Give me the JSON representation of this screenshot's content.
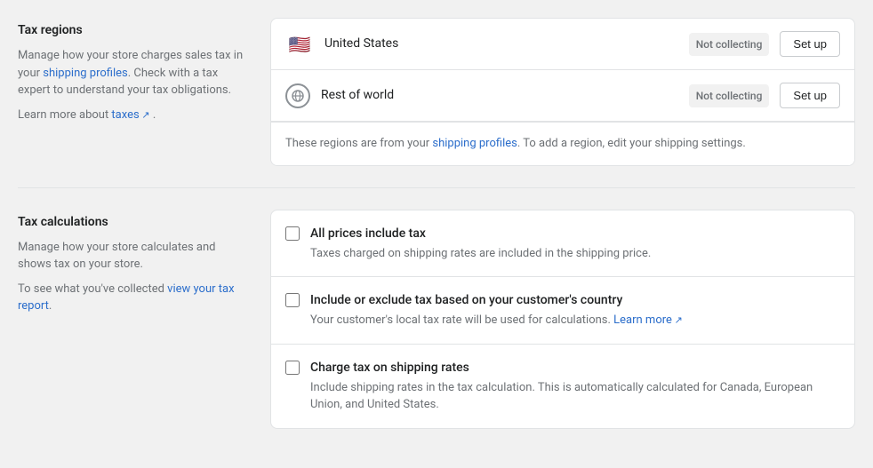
{
  "tax_regions": {
    "title": "Tax regions",
    "description_1": "Manage how your store charges sales tax in your ",
    "shipping_profiles_link": "shipping profiles",
    "description_2": ". Check with a tax expert to understand your tax obligations.",
    "learn_more_prefix": "Learn more about ",
    "taxes_link": "taxes",
    "regions": [
      {
        "id": "us",
        "flag": "🇺🇸",
        "name": "United States",
        "status": "Not collecting",
        "setup_label": "Set up"
      },
      {
        "id": "row",
        "flag": "🌐",
        "name": "Rest of world",
        "status": "Not collecting",
        "setup_label": "Set up"
      }
    ],
    "info_prefix": "These regions are from your ",
    "info_link": "shipping profiles",
    "info_suffix": ". To add a region, edit your shipping settings."
  },
  "tax_calculations": {
    "title": "Tax calculations",
    "description_1": "Manage how your store calculates and shows tax on your store.",
    "description_2": "To see what you've collected ",
    "report_link": "view your tax report",
    "checkboxes": [
      {
        "id": "all-prices-include-tax",
        "label": "All prices include tax",
        "description": "Taxes charged on shipping rates are included in the shipping price.",
        "has_link": false,
        "checked": false
      },
      {
        "id": "include-exclude-tax",
        "label": "Include or exclude tax based on your customer's country",
        "description": "Your customer's local tax rate will be used for calculations. ",
        "link_text": "Learn more",
        "has_link": true,
        "checked": false
      },
      {
        "id": "charge-tax-shipping",
        "label": "Charge tax on shipping rates",
        "description": "Include shipping rates in the tax calculation. This is automatically calculated for Canada, European Union, and United States.",
        "has_link": false,
        "checked": false
      }
    ]
  }
}
